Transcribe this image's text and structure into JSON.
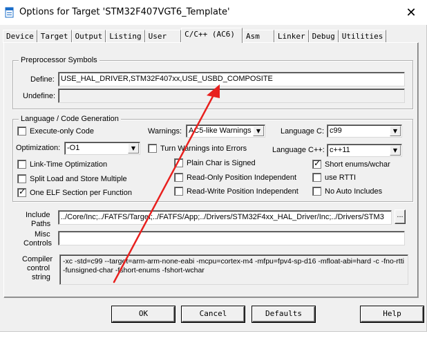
{
  "window": {
    "title": "Options for Target 'STM32F407VGT6_Template'",
    "close_glyph": "✕"
  },
  "tabs": [
    {
      "label": "Device"
    },
    {
      "label": "Target"
    },
    {
      "label": "Output"
    },
    {
      "label": "Listing"
    },
    {
      "label": "User"
    },
    {
      "label": "C/C++ (AC6)"
    },
    {
      "label": "Asm"
    },
    {
      "label": "Linker"
    },
    {
      "label": "Debug"
    },
    {
      "label": "Utilities"
    }
  ],
  "active_tab": "C/C++ (AC6)",
  "preprocessor": {
    "title": "Preprocessor Symbols",
    "define_label": "Define:",
    "define_value": "USE_HAL_DRIVER,STM32F407xx,USE_USBD_COMPOSITE",
    "undefine_label": "Undefine:",
    "undefine_value": ""
  },
  "language": {
    "title": "Language / Code Generation",
    "execute_only": {
      "label": "Execute-only Code",
      "checked": false
    },
    "optimization_label": "Optimization:",
    "optimization_value": "-O1",
    "link_time": {
      "label": "Link-Time Optimization",
      "checked": false
    },
    "split_load": {
      "label": "Split Load and Store Multiple",
      "checked": false
    },
    "one_elf": {
      "label": "One ELF Section per Function",
      "checked": true
    },
    "warnings_label": "Warnings:",
    "warnings_value": "AC5-like Warnings",
    "turn_warnings": {
      "label": "Turn Warnings into Errors",
      "checked": false
    },
    "plain_char": {
      "label": "Plain Char is Signed",
      "checked": false
    },
    "readonly_pos": {
      "label": "Read-Only Position Independent",
      "checked": false
    },
    "readwrite_pos": {
      "label": "Read-Write Position Independent",
      "checked": false
    },
    "language_c_label": "Language C:",
    "language_c_value": "c99",
    "language_cpp_label": "Language C++:",
    "language_cpp_value": "c++11",
    "short_enums": {
      "label": "Short enums/wchar",
      "checked": true
    },
    "use_rtti": {
      "label": "use RTTI",
      "checked": false
    },
    "no_auto_includes": {
      "label": "No Auto Includes",
      "checked": false
    }
  },
  "include_paths": {
    "label_line1": "Include",
    "label_line2": "Paths",
    "value": "../Core/Inc;../FATFS/Target;../FATFS/App;../Drivers/STM32F4xx_HAL_Driver/Inc;../Drivers/STM3",
    "browse_label": "..."
  },
  "misc_controls": {
    "label_line1": "Misc",
    "label_line2": "Controls",
    "value": ""
  },
  "compiler_string": {
    "label_line1": "Compiler",
    "label_line2": "control",
    "label_line3": "string",
    "value": "-xc -std=c99 --target=arm-arm-none-eabi -mcpu=cortex-m4 -mfpu=fpv4-sp-d16 -mfloat-abi=hard -c -fno-rtti -funsigned-char -fshort-enums -fshort-wchar"
  },
  "buttons": {
    "ok": "OK",
    "cancel": "Cancel",
    "defaults": "Defaults",
    "help": "Help"
  },
  "annotation_color": "#e8201e"
}
